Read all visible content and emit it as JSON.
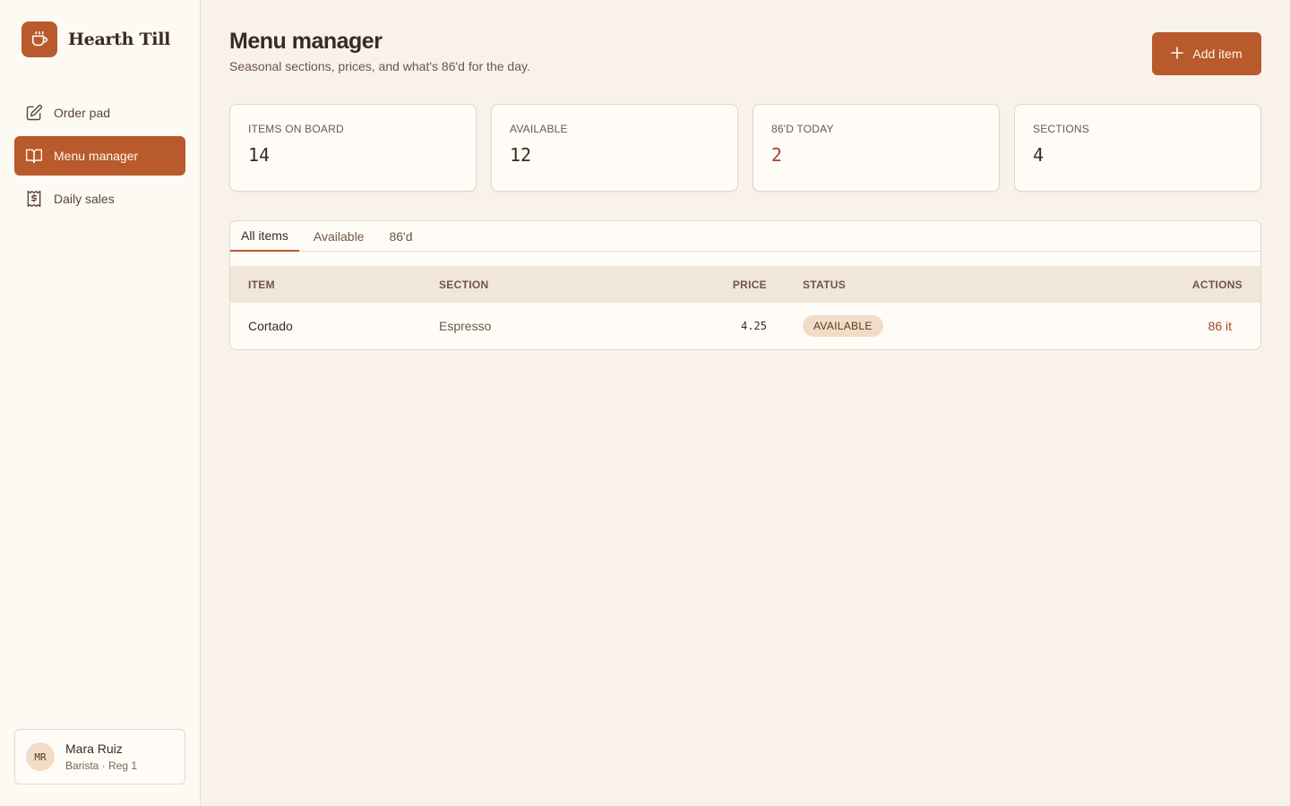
{
  "brand": {
    "name": "Hearth Till",
    "logo_icon": "coffee-cup-icon",
    "accent": "#b85a2b"
  },
  "nav": {
    "items": [
      {
        "label": "Order pad",
        "icon": "edit-icon",
        "active": false
      },
      {
        "label": "Menu manager",
        "icon": "book-open-icon",
        "active": true
      },
      {
        "label": "Daily sales",
        "icon": "receipt-dollar-icon",
        "active": false
      }
    ]
  },
  "user": {
    "initials": "MR",
    "name": "Mara Ruiz",
    "role": "Barista · Reg 1"
  },
  "header": {
    "title": "Menu manager",
    "subtitle": "Seasonal sections, prices, and what's 86'd for the day.",
    "add_button": "Add item"
  },
  "stats": [
    {
      "label": "ITEMS ON BOARD",
      "value": "14"
    },
    {
      "label": "AVAILABLE",
      "value": "12"
    },
    {
      "label": "86'D TODAY",
      "value": "2",
      "color": "#a5442a"
    },
    {
      "label": "SECTIONS",
      "value": "4"
    }
  ],
  "tabs": [
    {
      "label": "All items",
      "active": true
    },
    {
      "label": "Available",
      "active": false
    },
    {
      "label": "86'd",
      "active": false
    }
  ],
  "table": {
    "columns": {
      "item": "ITEM",
      "section": "SECTION",
      "price": "PRICE",
      "status": "STATUS",
      "actions": "ACTIONS"
    },
    "rows": [
      {
        "item": "Cortado",
        "section": "Espresso",
        "price": "4.25",
        "status": "AVAILABLE",
        "action": "86 it"
      }
    ]
  }
}
